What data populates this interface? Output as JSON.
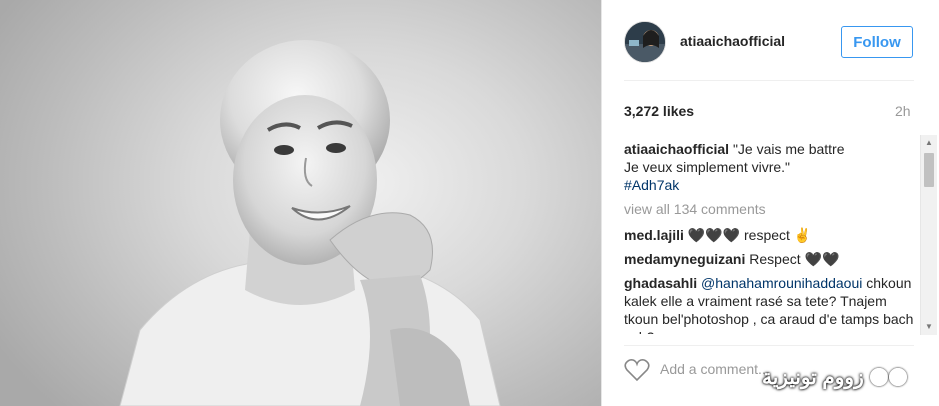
{
  "post": {
    "username": "atiaaichaofficial",
    "follow_label": "Follow",
    "likes": "3,272 likes",
    "time": "2h",
    "caption": {
      "username": "atiaaichaofficial",
      "line1": "\"Je vais me battre",
      "line2": "Je veux simplement vivre.\"",
      "hashtag": "#Adh7ak"
    },
    "view_all": "view all 134 comments",
    "comments": [
      {
        "user": "med.lajili",
        "text": "🖤🖤🖤 respect ✌"
      },
      {
        "user": "medamyneguizani",
        "text": "Respect 🖤🖤"
      },
      {
        "user": "ghadasahli",
        "mention": "@hanahamrounihaddaoui",
        "text": "chkoun kalek elle a vraiment rasé sa tete? Tnajem tkoun bel'photoshop , ca araud d'e tamps bach ech?"
      }
    ],
    "add_comment_placeholder": "Add a comment..."
  },
  "watermark": {
    "text": "زووم تونيزية"
  }
}
